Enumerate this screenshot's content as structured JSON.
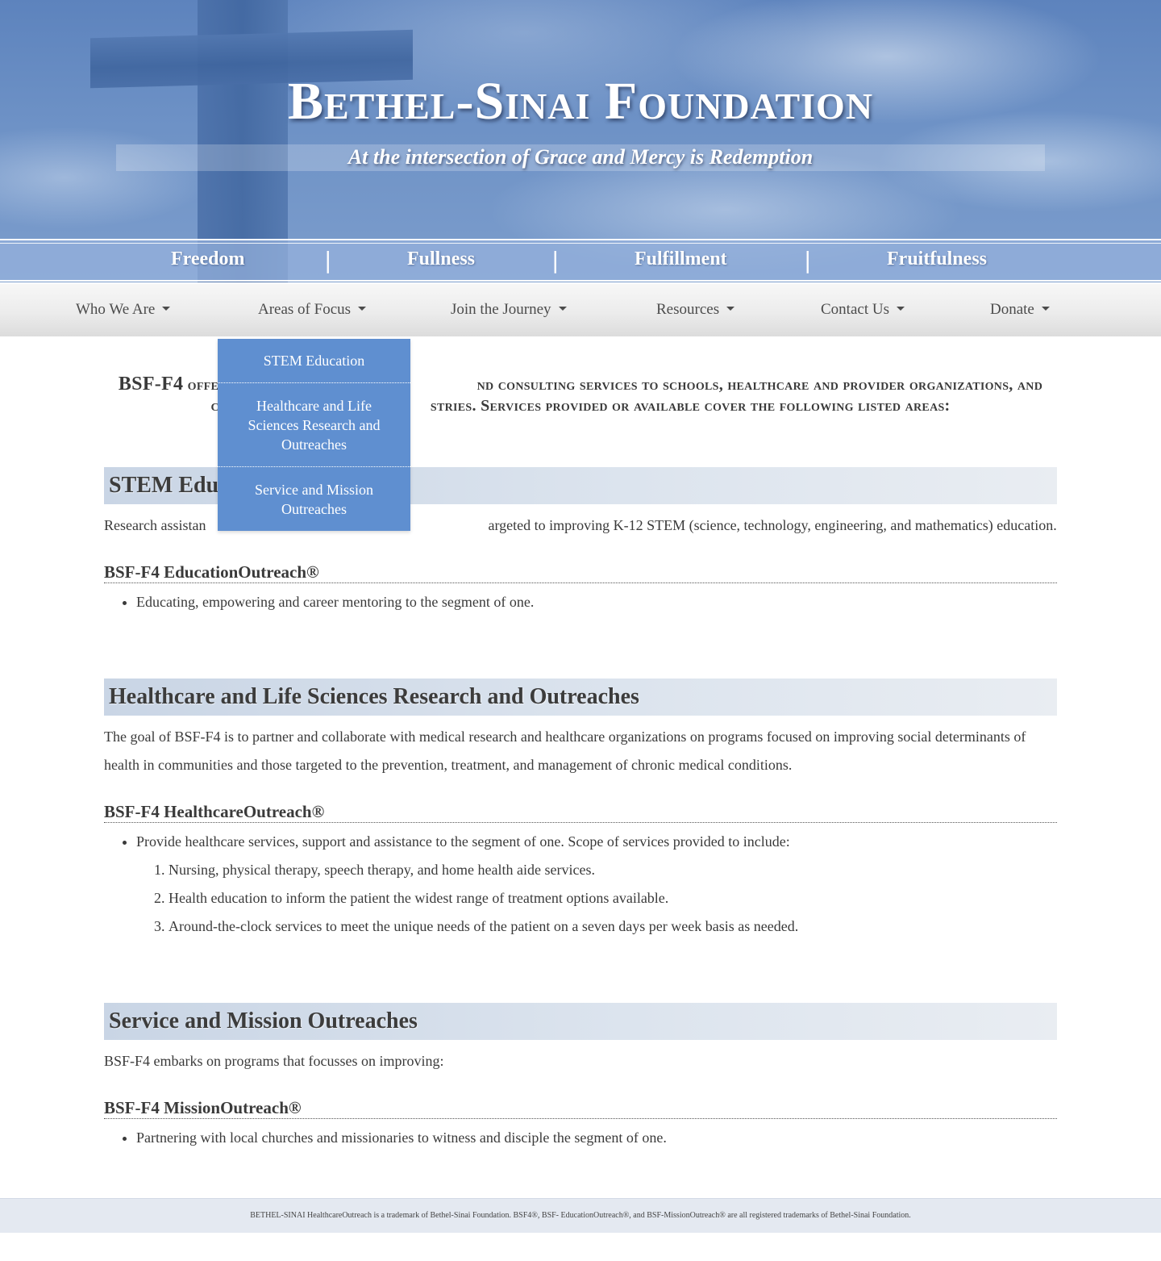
{
  "site": {
    "title": "Bethel-Sinai Foundation",
    "tagline": "At the intersection of Grace and Mercy is Redemption"
  },
  "pillars": [
    "Freedom",
    "Fullness",
    "Fulfillment",
    "Fruitfulness"
  ],
  "pillar_separator": "|",
  "nav": {
    "items": [
      {
        "label": "Who We Are"
      },
      {
        "label": "Areas of Focus"
      },
      {
        "label": "Join the Journey"
      },
      {
        "label": "Resources"
      },
      {
        "label": "Contact Us"
      },
      {
        "label": "Donate"
      }
    ],
    "open_menu": "Areas of Focus"
  },
  "dropdown": {
    "items": [
      {
        "label": "STEM Education"
      },
      {
        "label": "Healthcare and Life Sciences Research and Outreaches"
      },
      {
        "label": "Service and Mission Outreaches"
      }
    ]
  },
  "intro": {
    "lead": "BSF-F4",
    "line1_visible_start": "offer",
    "line1_visible_end": "nd consulting services to schools, healthcare and provider organizations, and",
    "line2_visible_start": "chur",
    "line2_visible_end": "stries. Services provided or available cover the following listed areas:"
  },
  "sections": {
    "stem": {
      "heading_visible": "STEM Edu",
      "text_start": "Research assistan",
      "text_end": "argeted to improving K-12 STEM (science, technology, engineering, and mathematics) education.",
      "subheading": "BSF-F4 EducationOutreach®",
      "bullets": [
        "Educating, empowering and career mentoring to the segment of one."
      ]
    },
    "health": {
      "heading": "Healthcare and Life Sciences Research and Outreaches",
      "text": "The goal of BSF-F4 is to partner and collaborate with medical research and healthcare organizations on programs focused on improving social determinants of health in communities and those targeted to the prevention, treatment, and management of chronic medical conditions.",
      "subheading": "BSF-F4 HealthcareOutreach®",
      "bullet": "Provide healthcare services, support and assistance to the segment of one. Scope of services provided to include:",
      "numbered": [
        "Nursing, physical therapy, speech therapy, and home health aide services.",
        "Health education to inform the patient the widest range of treatment options available.",
        "Around-the-clock services to meet the unique needs of the patient on a seven days per week basis as needed."
      ]
    },
    "mission": {
      "heading": "Service and Mission Outreaches",
      "text": "BSF-F4 embarks on programs that focusses on improving:",
      "subheading": "BSF-F4 MissionOutreach®",
      "bullets": [
        "Partnering with local churches and missionaries to witness and disciple the segment of one."
      ]
    }
  },
  "footer": {
    "text": "BETHEL-SINAI HealthcareOutreach is a trademark of Bethel-Sinai Foundation. BSF4®, BSF- EducationOutreach®, and BSF-MissionOutreach® are all registered trademarks of Bethel-Sinai Foundation."
  },
  "colors": {
    "dropdown_bg": "#5f8fd0",
    "section_head_bg": "#c9d5e5",
    "footer_bg": "#e4e9f1",
    "sky": "#6e92c6"
  }
}
